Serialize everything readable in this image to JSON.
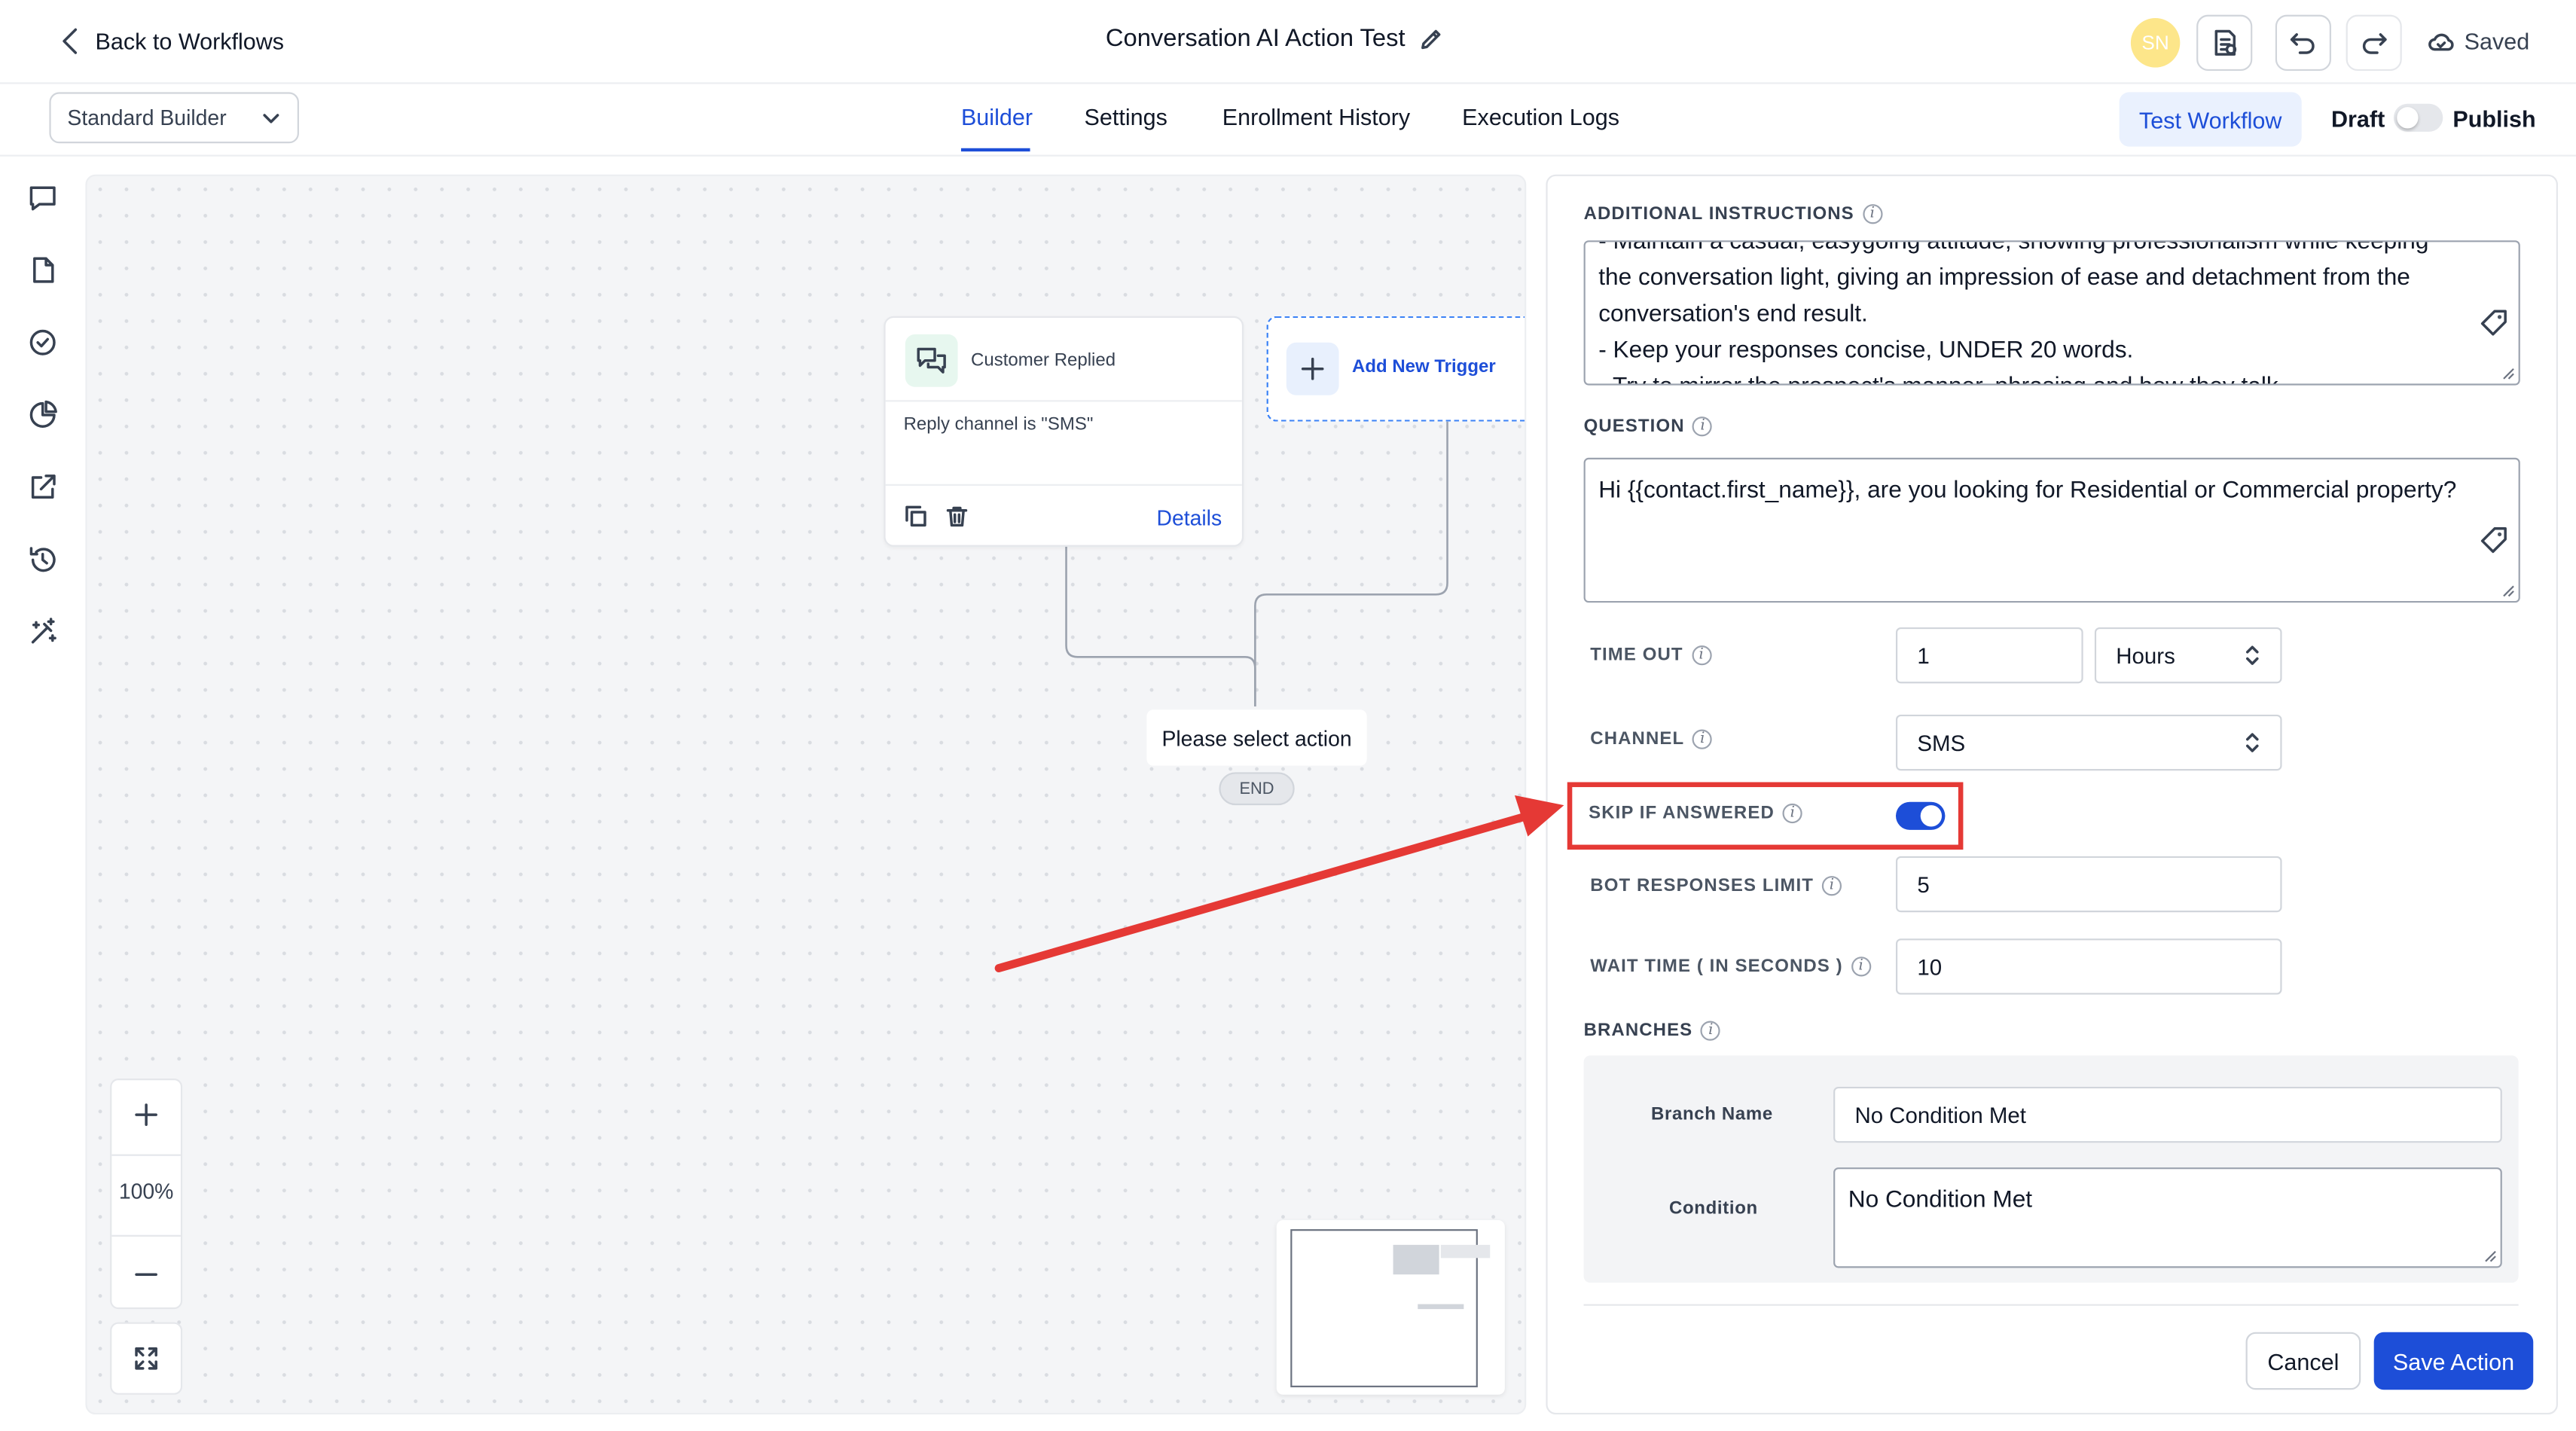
{
  "header": {
    "back_label": "Back to Workflows",
    "workflow_title": "Conversation AI Action Test",
    "avatar_initials": "SN",
    "saved_label": "Saved"
  },
  "toolbar": {
    "builder_mode": "Standard Builder",
    "tabs": [
      {
        "label": "Builder",
        "active": true
      },
      {
        "label": "Settings",
        "active": false
      },
      {
        "label": "Enrollment History",
        "active": false
      },
      {
        "label": "Execution Logs",
        "active": false
      }
    ],
    "test_label": "Test Workflow",
    "draft_label": "Draft",
    "publish_label": "Publish",
    "publish_enabled": false
  },
  "sidebar": {
    "icons": [
      "chat-icon",
      "document-icon",
      "check-circle-icon",
      "pie-chart-icon",
      "external-link-icon",
      "history-icon",
      "ai-sparkle-icon"
    ]
  },
  "canvas": {
    "trigger": {
      "title": "Customer Replied",
      "filter": "Reply channel is \"SMS\"",
      "details_label": "Details"
    },
    "add_trigger_label": "Add New Trigger",
    "action_placeholder": "Please select action",
    "end_label": "END",
    "zoom_level": "100%"
  },
  "panel": {
    "additional_instructions": {
      "label": "ADDITIONAL INSTRUCTIONS",
      "lines": [
        "- Maintain a casual, easygoing attitude, showing professionalism while keeping",
        "the conversation light, giving an impression of ease and detachment from the",
        "conversation's end result.",
        "- Keep your responses concise, UNDER 20 words.",
        "- Try to mirror the prospect's manner, phrasing and how they talk"
      ]
    },
    "question": {
      "label": "QUESTION",
      "value": "Hi {{contact.first_name}}, are you looking for Residential or Commercial property?"
    },
    "timeout": {
      "label": "TIME OUT",
      "value": "1",
      "unit": "Hours"
    },
    "channel": {
      "label": "CHANNEL",
      "value": "SMS"
    },
    "skip_if_answered": {
      "label": "SKIP IF ANSWERED",
      "enabled": true
    },
    "bot_responses_limit": {
      "label": "BOT RESPONSES LIMIT",
      "value": "5"
    },
    "wait_time": {
      "label": "WAIT TIME ( IN SECONDS )",
      "value": "10"
    },
    "branches": {
      "label": "BRANCHES",
      "branch_name_label": "Branch Name",
      "branch_name_value": "No Condition Met",
      "condition_label": "Condition",
      "condition_value": "No Condition Met"
    },
    "cancel_label": "Cancel",
    "save_label": "Save Action"
  },
  "colors": {
    "accent": "#1d4ed8",
    "highlight": "#e53935",
    "trigger_icon": "#10b981"
  }
}
